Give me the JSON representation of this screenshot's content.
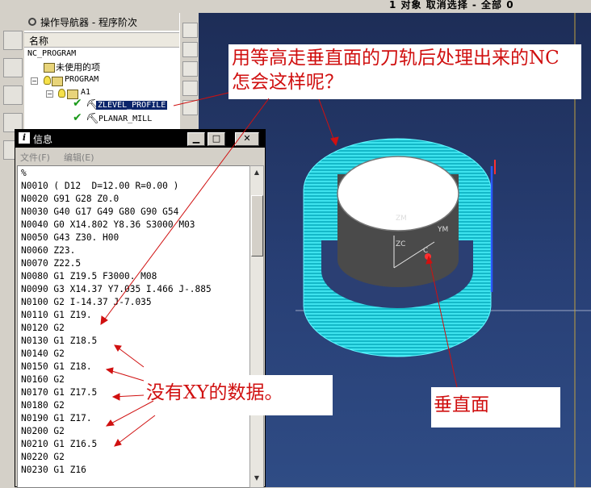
{
  "status_bar": {
    "text": "1 对象 取消选择 - 全部 0"
  },
  "navigator": {
    "title": "操作导航器 - 程序阶次",
    "column_header": "名称",
    "tree": [
      {
        "label": "NC_PROGRAM"
      },
      {
        "label": "未使用的项"
      },
      {
        "label": "PROGRAM"
      },
      {
        "label": "A1"
      },
      {
        "label": "ZLEVEL_PROFILE",
        "selected": true
      },
      {
        "label": "PLANAR_MILL"
      }
    ]
  },
  "info_window": {
    "title": "信息",
    "menu": {
      "file": "文件(F)",
      "edit": "编辑(E)"
    },
    "buttons": {
      "minimize": "▁",
      "maximize": "□",
      "close": "✕"
    },
    "lines": [
      "%",
      "N0010 ( D12  D=12.00 R=0.00 )",
      "N0020 G91 G28 Z0.0",
      "N0030 G40 G17 G49 G80 G90 G54",
      "N0040 G0 X14.802 Y8.36 S3000 M03",
      "N0050 G43 Z30. H00",
      "N0060 Z23.",
      "N0070 Z22.5",
      "N0080 G1 Z19.5 F3000. M08",
      "N0090 G3 X14.37 Y7.035 I.466 J-.885",
      "N0100 G2 I-14.37 J-7.035",
      "N0110 G1 Z19.",
      "N0120 G2",
      "N0130 G1 Z18.5",
      "N0140 G2",
      "N0150 G1 Z18.",
      "N0160 G2",
      "N0170 G1 Z17.5",
      "N0180 G2",
      "N0190 G1 Z17.",
      "N0200 G2",
      "N0210 G1 Z16.5",
      "N0220 G2",
      "N0230 G1 Z16"
    ]
  },
  "viewport": {
    "axis_labels": {
      "zm": "ZM",
      "ym": "YM",
      "zc": "ZC",
      "c": "C"
    }
  },
  "annotations": {
    "question": "用等高走垂直面的刀轨后处理出来的NC怎会这样呢？",
    "no_xy": "没有XY的数据。",
    "vertical_face": "垂直面"
  },
  "colors": {
    "annotation": "#d01010",
    "toolpath": "#22e8f0",
    "selection": "#0a246a",
    "viewport_bg": "#253a6c"
  }
}
